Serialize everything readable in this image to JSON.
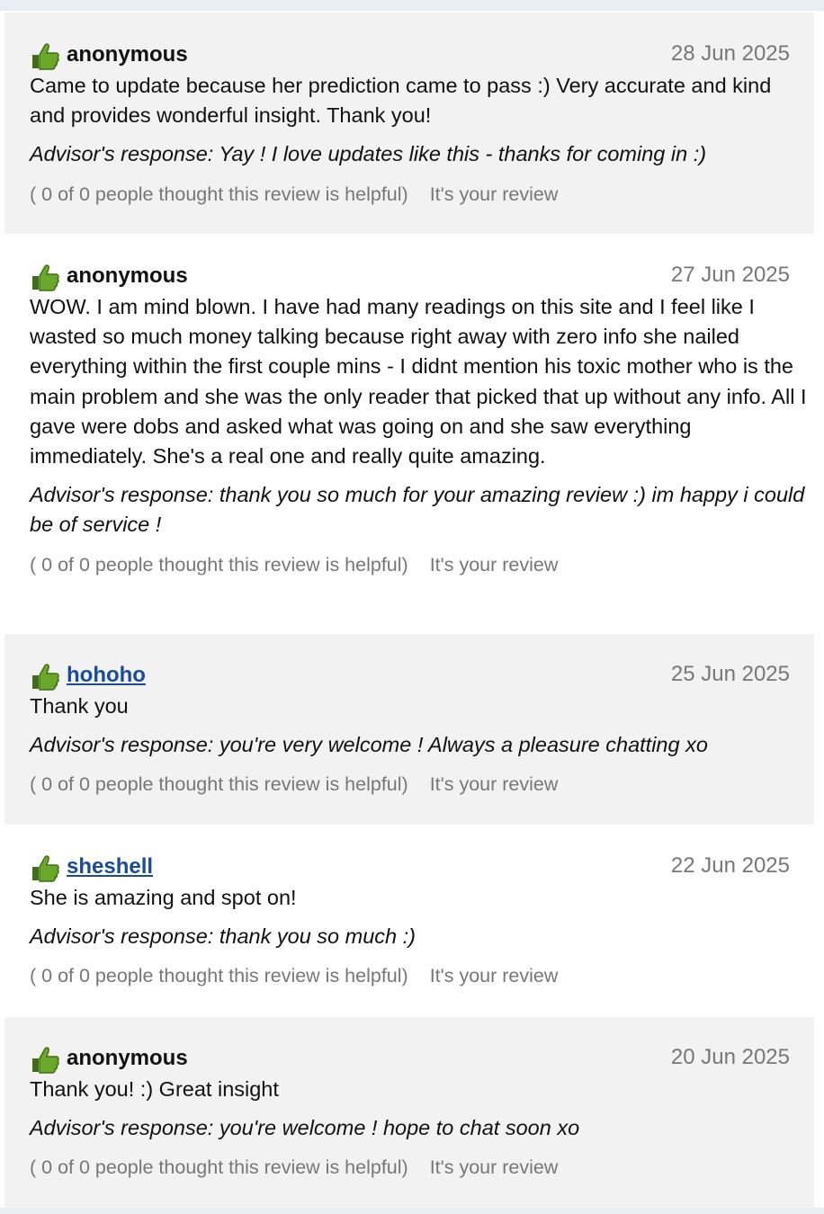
{
  "reviews": [
    {
      "user": "anonymous",
      "user_is_link": false,
      "date": "28 Jun 2025",
      "text": "Came to update because her prediction came to pass :) Very accurate and kind and provides wonderful insight. Thank you!",
      "response": "Advisor's response: Yay ! I love updates like this - thanks for coming in :)",
      "helpful": "( 0 of 0 people thought this review is helpful)",
      "own_review": "It's your review",
      "icon": "thumbs-up-icon"
    },
    {
      "user": "anonymous",
      "user_is_link": false,
      "date": "27 Jun 2025",
      "text": "WOW. I am mind blown. I have had many readings on this site and I feel like I wasted so much money talking because right away with zero info she nailed everything within the first couple mins - I didnt mention his toxic mother who is the main problem and she was the only reader that picked that up without any info. All I gave were dobs and asked what was going on and she saw everything immediately. She's a real one and really quite amazing.",
      "response": "Advisor's response: thank you so much for your amazing review :) im happy i could be of service !",
      "helpful": "( 0 of 0 people thought this review is helpful)",
      "own_review": "It's your review",
      "icon": "thumbs-up-icon"
    },
    {
      "user": "hohoho",
      "user_is_link": true,
      "date": "25 Jun 2025",
      "text": "Thank you",
      "response": "Advisor's response: you're very welcome ! Always a pleasure chatting xo",
      "helpful": "( 0 of 0 people thought this review is helpful)",
      "own_review": "It's your review",
      "icon": "thumbs-up-icon"
    },
    {
      "user": "sheshell",
      "user_is_link": true,
      "date": "22 Jun 2025",
      "text": "She is amazing and spot on!",
      "response": "Advisor's response: thank you so much :)",
      "helpful": "( 0 of 0 people thought this review is helpful)",
      "own_review": "It's your review",
      "icon": "thumbs-up-icon"
    },
    {
      "user": "anonymous",
      "user_is_link": false,
      "date": "20 Jun 2025",
      "text": "Thank you! :) Great insight",
      "response": "Advisor's response: you're welcome ! hope to chat soon xo",
      "helpful": "( 0 of 0 people thought this review is helpful)",
      "own_review": "It's your review",
      "icon": "thumbs-up-icon"
    }
  ],
  "colors": {
    "shaded_background": "#f2f2f2",
    "link": "#1a4a9c",
    "muted": "#777777",
    "thumb_green": "#6aa82a"
  }
}
